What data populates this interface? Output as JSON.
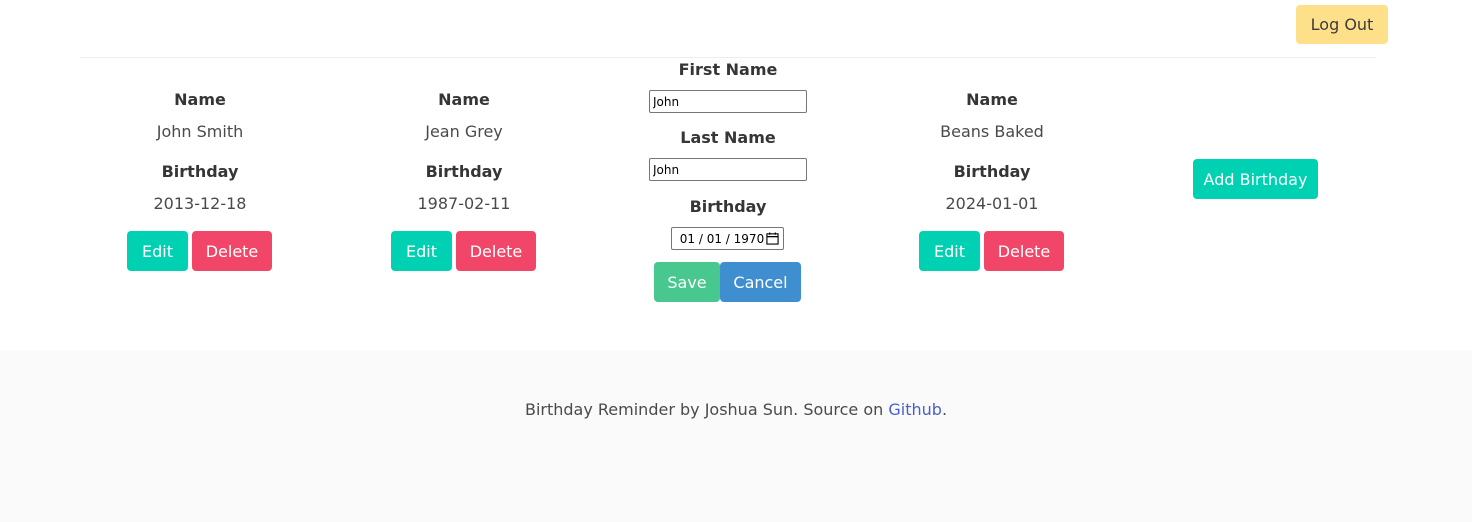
{
  "nav": {
    "logout_label": "Log Out"
  },
  "labels": {
    "name": "Name",
    "birthday": "Birthday",
    "first_name": "First Name",
    "last_name": "Last Name"
  },
  "cards": [
    {
      "name": "John Smith",
      "birthday": "2013-12-18",
      "edit_label": "Edit",
      "delete_label": "Delete"
    },
    {
      "name": "Jean Grey",
      "birthday": "1987-02-11",
      "edit_label": "Edit",
      "delete_label": "Delete"
    },
    {
      "name": "Beans Baked",
      "birthday": "2024-01-01",
      "edit_label": "Edit",
      "delete_label": "Delete"
    }
  ],
  "edit_form": {
    "first_name_value": "John",
    "last_name_value": "John",
    "birthday_value": "01 / 01 / 1970",
    "save_label": "Save",
    "cancel_label": "Cancel"
  },
  "add_birthday_label": "Add Birthday",
  "footer": {
    "text_before": "Birthday Reminder by Joshua Sun. Source on ",
    "link_text": "Github",
    "text_after": "."
  },
  "icons": {
    "calendar": "calendar-icon"
  },
  "colors": {
    "primary": "#00d1b2",
    "danger": "#f14668",
    "success": "#48c78e",
    "info": "#3e8ed0",
    "warning": "#ffe08a",
    "link": "#485fc7"
  }
}
